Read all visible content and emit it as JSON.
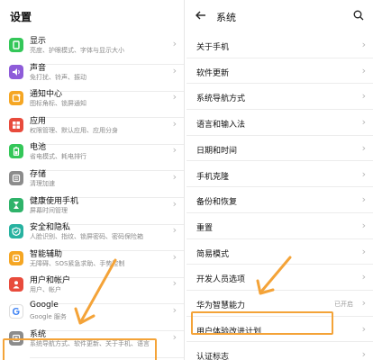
{
  "left": {
    "title": "设置",
    "items": [
      {
        "label": "显示",
        "sub": "亮度、护眼模式、字体与显示大小",
        "icon": "display-icon",
        "color": "#34c759"
      },
      {
        "label": "声音",
        "sub": "免打扰、铃声、振动",
        "icon": "sound-icon",
        "color": "#8e5cd9"
      },
      {
        "label": "通知中心",
        "sub": "图标角标、锁屏通知",
        "icon": "notification-icon",
        "color": "#f5a623"
      },
      {
        "label": "应用",
        "sub": "权限管理、默认应用、应用分身",
        "icon": "apps-icon",
        "color": "#e84b3c"
      },
      {
        "label": "电池",
        "sub": "省电模式、耗电排行",
        "icon": "battery-icon",
        "color": "#34c759"
      },
      {
        "label": "存储",
        "sub": "清理加速",
        "icon": "storage-icon",
        "color": "#8c8c8c"
      },
      {
        "label": "健康使用手机",
        "sub": "屏幕时间管理",
        "icon": "hourglass-icon",
        "color": "#2fb36a"
      },
      {
        "label": "安全和隐私",
        "sub": "人脸识别、指纹、锁屏密码、密码保险箱",
        "icon": "security-icon",
        "color": "#27b2a0"
      },
      {
        "label": "智能辅助",
        "sub": "无障碍、SOS紧急求助、手势控制",
        "icon": "assist-icon",
        "color": "#f5a623"
      },
      {
        "label": "用户和帐户",
        "sub": "用户、帐户",
        "icon": "user-icon",
        "color": "#e84b3c"
      },
      {
        "label": "Google",
        "sub": "Google 服务",
        "icon": "google-icon",
        "color": "#ffffff"
      },
      {
        "label": "系统",
        "sub": "系统导航方式、软件更新、关于手机、语言",
        "icon": "system-icon",
        "color": "#8c8c8c"
      }
    ]
  },
  "right": {
    "title": "系统",
    "items": [
      {
        "label": "关于手机",
        "value": ""
      },
      {
        "label": "软件更新",
        "value": ""
      },
      {
        "label": "系统导航方式",
        "value": ""
      },
      {
        "label": "语言和输入法",
        "value": ""
      },
      {
        "label": "日期和时间",
        "value": ""
      },
      {
        "label": "手机克隆",
        "value": ""
      },
      {
        "label": "备份和恢复",
        "value": ""
      },
      {
        "label": "重置",
        "value": ""
      },
      {
        "label": "简易模式",
        "value": ""
      },
      {
        "label": "开发人员选项",
        "value": ""
      },
      {
        "label": "华为智慧能力",
        "value": "已开启"
      },
      {
        "label": "用户体验改进计划",
        "value": ""
      },
      {
        "label": "认证标志",
        "value": ""
      }
    ]
  },
  "accent": "#f4a338"
}
